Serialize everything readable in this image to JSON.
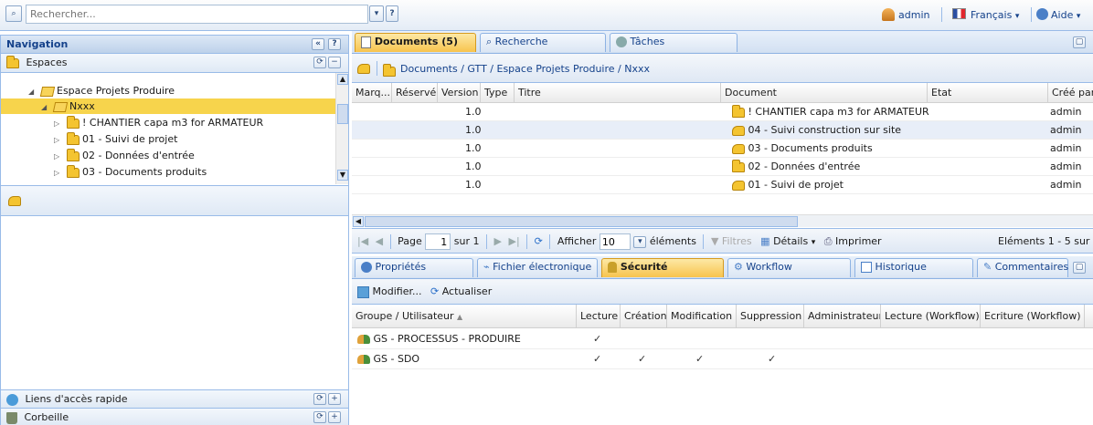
{
  "topbar": {
    "search_placeholder": "Rechercher...",
    "help_glyph": "?",
    "user": "admin",
    "language": "Français",
    "help": "Aide"
  },
  "navigation": {
    "title": "Navigation",
    "spaces_title": "Espaces",
    "tree": [
      {
        "label": "Espace Projets Produire",
        "level": 1,
        "expanded": true
      },
      {
        "label": "Nxxx",
        "level": 2,
        "expanded": true,
        "selected": true
      },
      {
        "label": "! CHANTIER capa m3 for ARMATEUR",
        "level": 3
      },
      {
        "label": "01 - Suivi de projet",
        "level": 3
      },
      {
        "label": "02 - Données d'entrée",
        "level": 3
      },
      {
        "label": "03 - Documents produits",
        "level": 3
      }
    ],
    "quick_links": "Liens d'accès rapide",
    "trash": "Corbeille"
  },
  "tabs": {
    "documents": "Documents (5)",
    "search": "Recherche",
    "tasks": "Tâches"
  },
  "breadcrumb": "Documents / GTT / Espace Projets Produire / Nxxx",
  "doc_grid": {
    "columns": [
      "Marq...",
      "Réservé",
      "Version",
      "Type",
      "Titre",
      "Document",
      "Etat",
      "Créé par"
    ],
    "rows": [
      {
        "version": "1.0",
        "document": "! CHANTIER capa m3 for ARMATEUR",
        "created_by": "admin",
        "icon": "folder-icon"
      },
      {
        "version": "1.0",
        "document": "04 - Suivi construction sur site",
        "created_by": "admin",
        "icon": "gear-folder-icon"
      },
      {
        "version": "1.0",
        "document": "03 - Documents produits",
        "created_by": "admin",
        "icon": "gear-folder-icon"
      },
      {
        "version": "1.0",
        "document": "02 - Données d'entrée",
        "created_by": "admin",
        "icon": "folder-icon"
      },
      {
        "version": "1.0",
        "document": "01 - Suivi de projet",
        "created_by": "admin",
        "icon": "gear-folder-icon"
      }
    ]
  },
  "pager": {
    "page_label": "Page",
    "page_value": "1",
    "of_label": "sur 1",
    "show_label": "Afficher",
    "show_value": "10",
    "items_label": "éléments",
    "filters_label": "Filtres",
    "details_label": "Détails",
    "print_label": "Imprimer",
    "count_label": "Eléments 1 - 5 sur"
  },
  "detail_tabs": {
    "properties": "Propriétés",
    "file": "Fichier électronique",
    "security": "Sécurité",
    "workflow": "Workflow",
    "history": "Historique",
    "comments": "Commentaires"
  },
  "security_toolbar": {
    "modify": "Modifier...",
    "refresh": "Actualiser"
  },
  "security_grid": {
    "columns": [
      "Groupe / Utilisateur",
      "Lecture",
      "Création",
      "Modification",
      "Suppression",
      "Administrateur",
      "Lecture (Workflow)",
      "Ecriture (Workflow)"
    ],
    "sort_glyph": "▲",
    "check_glyph": "✓",
    "rows": [
      {
        "name": "GS - PROCESSUS - PRODUIRE",
        "perms": [
          true,
          false,
          false,
          false,
          false,
          false,
          false
        ]
      },
      {
        "name": "GS - SDO",
        "perms": [
          true,
          true,
          true,
          true,
          false,
          false,
          false
        ]
      }
    ]
  }
}
